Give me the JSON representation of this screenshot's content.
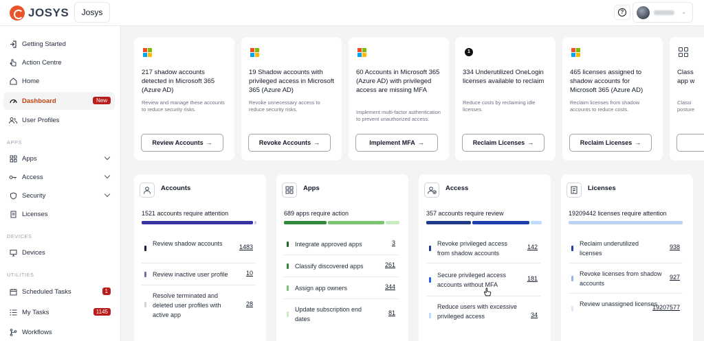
{
  "header": {
    "logo_text": "JOSYS",
    "tenant": "Josys",
    "help_icon": "question-circle-icon"
  },
  "sidebar": {
    "items": [
      {
        "label": "Getting Started",
        "icon": "login-icon"
      },
      {
        "label": "Action Centre",
        "icon": "pointer-icon"
      },
      {
        "label": "Home",
        "icon": "home-icon"
      },
      {
        "label": "Dashboard",
        "icon": "gauge-icon",
        "badge": "New",
        "active": true
      },
      {
        "label": "User Profiles",
        "icon": "users-icon"
      }
    ],
    "section_apps": "APPS",
    "apps_items": [
      {
        "label": "Apps",
        "icon": "grid-icon"
      },
      {
        "label": "Access",
        "icon": "key-icon"
      },
      {
        "label": "Security",
        "icon": "shield-icon"
      },
      {
        "label": "Licenses",
        "icon": "license-icon"
      }
    ],
    "section_devices": "DEVICES",
    "devices_items": [
      {
        "label": "Devices",
        "icon": "monitor-icon"
      }
    ],
    "section_utilities": "UTILITIES",
    "utilities_items": [
      {
        "label": "Scheduled Tasks",
        "icon": "calendar-icon",
        "count": "1"
      },
      {
        "label": "My Tasks",
        "icon": "list-icon",
        "count": "1145"
      },
      {
        "label": "Workflows",
        "icon": "workflow-icon"
      }
    ]
  },
  "action_cards": [
    {
      "title": "217 shadow accounts detected in Microsoft 365 (Azure AD)",
      "desc": "Review and manage these accounts to reduce security risks.",
      "button": "Review Accounts"
    },
    {
      "title": "19 Shadow accounts with privileged access in Microsoft 365 (Azure AD)",
      "desc": "Revoke unnecessary access to reduce security risks.",
      "button": "Revoke Accounts"
    },
    {
      "title": "60 Accounts in Microsoft 365 (Azure AD) with privileged access are missing MFA",
      "desc": "Implement multi-factor authentication to prevent unauthorized access.",
      "button": "Implement MFA"
    },
    {
      "title": "334 Underutilized OneLogin licenses available to reclaim",
      "desc": "Reduce costs by reclaiming idle licenses.",
      "button": "Reclaim Licenses"
    },
    {
      "title": "465 licenses assigned to shadow accounts for Microsoft 365 (Azure AD)",
      "desc": "Reclaim licenses from shadow accounts to reduce costs.",
      "button": "Reclaim Licenses"
    },
    {
      "title": "Class app w",
      "desc": "Classi posture",
      "button": ""
    }
  ],
  "categories": [
    {
      "title": "Accounts",
      "summary": "1521 accounts require attention",
      "rows": [
        {
          "text": "Review shadow accounts",
          "count": "1483"
        },
        {
          "text": "Review inactive user profile",
          "count": "10"
        },
        {
          "text": "Resolve terminated and deleted user profiles with active app",
          "count": "28"
        }
      ]
    },
    {
      "title": "Apps",
      "summary": "689 apps require action",
      "rows": [
        {
          "text": "Integrate approved apps",
          "count": "3"
        },
        {
          "text": "Classify discovered apps",
          "count": "261"
        },
        {
          "text": "Assign app owners",
          "count": "344"
        },
        {
          "text": "Update subscription end dates",
          "count": "81"
        }
      ]
    },
    {
      "title": "Access",
      "summary": "357 accounts require review",
      "rows": [
        {
          "text": "Revoke privileged access from shadow accounts",
          "count": "142"
        },
        {
          "text": "Secure privileged access accounts without MFA",
          "count": "181"
        },
        {
          "text": "Reduce users with excessive privileged access",
          "count": "34"
        }
      ]
    },
    {
      "title": "Licenses",
      "summary": "19209442 licenses require attention",
      "rows": [
        {
          "text": "Reclaim underutilized licenses",
          "count": "938"
        },
        {
          "text": "Revoke licenses from shadow accounts",
          "count": "927"
        },
        {
          "text": "Review unassigned licenses",
          "count": "19207577"
        }
      ]
    }
  ],
  "colors": {
    "accent": "#c2410c",
    "badge": "#b91c1c",
    "accounts_bar": "#3730a3",
    "apps_bar_dark": "#2f8a3a",
    "apps_bar_mid": "#7cc46d",
    "apps_bar_light": "#c9ebc0",
    "access_bar_dark": "#1e3a8a",
    "access_bar_mid": "#2563eb",
    "licenses_bar": "#bcd2f0"
  }
}
